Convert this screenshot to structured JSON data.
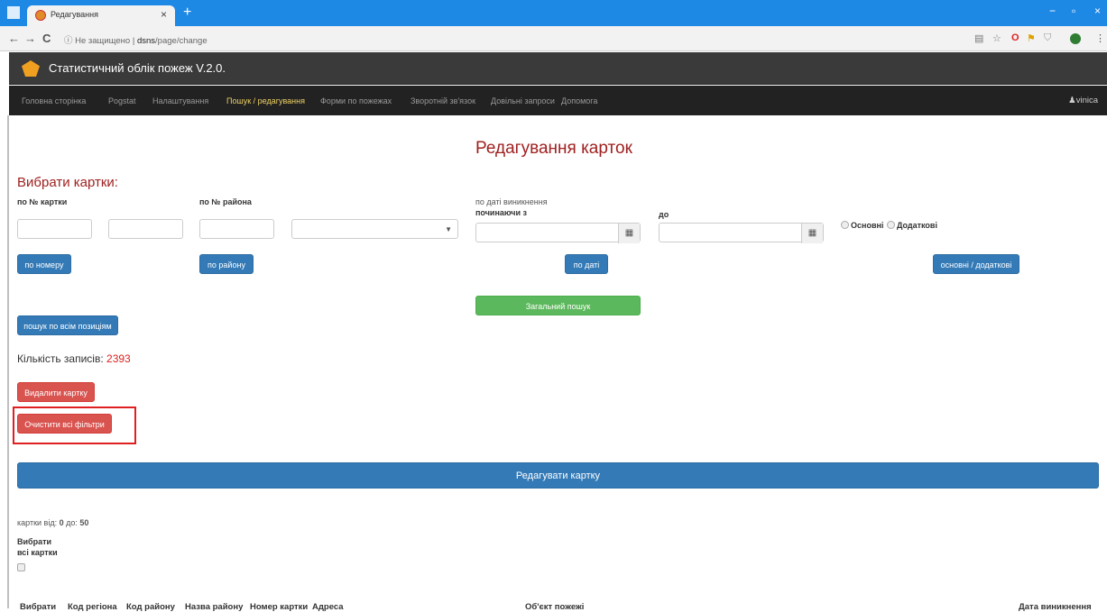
{
  "browser": {
    "tab_title": "Редагування",
    "tab_close": "×",
    "new_tab": "+",
    "url_security": "ⓘ Не защищено",
    "url_separator": "|",
    "url_host": "dsns",
    "url_path": "/page/change",
    "win_min": "−",
    "win_max": "▫",
    "win_close": "×",
    "back": "←",
    "forward": "→",
    "reload": "C"
  },
  "app": {
    "title": "Статистичний облік пожеж V.2.0."
  },
  "nav": {
    "items": [
      "Головна сторінка",
      "Pogstat",
      "Налаштування",
      "Пошук / редагування",
      "Форми по пожежах",
      "Зворотній зв'язок",
      "Довільні запроси",
      "Допомога"
    ],
    "active_index": 3,
    "user": "vinica"
  },
  "page": {
    "heading": "Редагування карток",
    "subheading": "Вибрати картки:"
  },
  "filters": {
    "card_no_label": "по № картки",
    "district_no_label": "по № района",
    "date_label": "по даті виникнення",
    "from_label": "починаючи з",
    "to_label": "до",
    "radio_main": "Основні",
    "radio_extra": "Додаткові",
    "btn_by_number": "по номеру",
    "btn_by_district": "по району",
    "btn_by_date": "по даті",
    "btn_main_extra": "основні / додаткові",
    "btn_general": "Загальний пошук",
    "btn_all_positions": "пошук по всім позиціям"
  },
  "records": {
    "count_label": "Кількість записів:",
    "count_value": "2393"
  },
  "actions": {
    "delete_card": "Видалити картку",
    "clear_filters": "Очистити всі фільтри",
    "edit_card": "Редагувати картку"
  },
  "paging": {
    "label_from": "картки від:",
    "from": "0",
    "label_to": "до:",
    "to": "50",
    "select_all_line1": "Вибрати",
    "select_all_line2": "всі картки"
  },
  "table": {
    "headers": [
      "Вибрати",
      "Код регіона",
      "Код району",
      "Назва району",
      "Номер картки",
      "Адреса",
      "Об'єкт пожежі",
      "Дата виникнення"
    ]
  },
  "colors": {
    "heading": "#a02020",
    "primary": "#337ab7",
    "success": "#5cb85c",
    "danger": "#d9534f",
    "highlight": "#e02020"
  }
}
